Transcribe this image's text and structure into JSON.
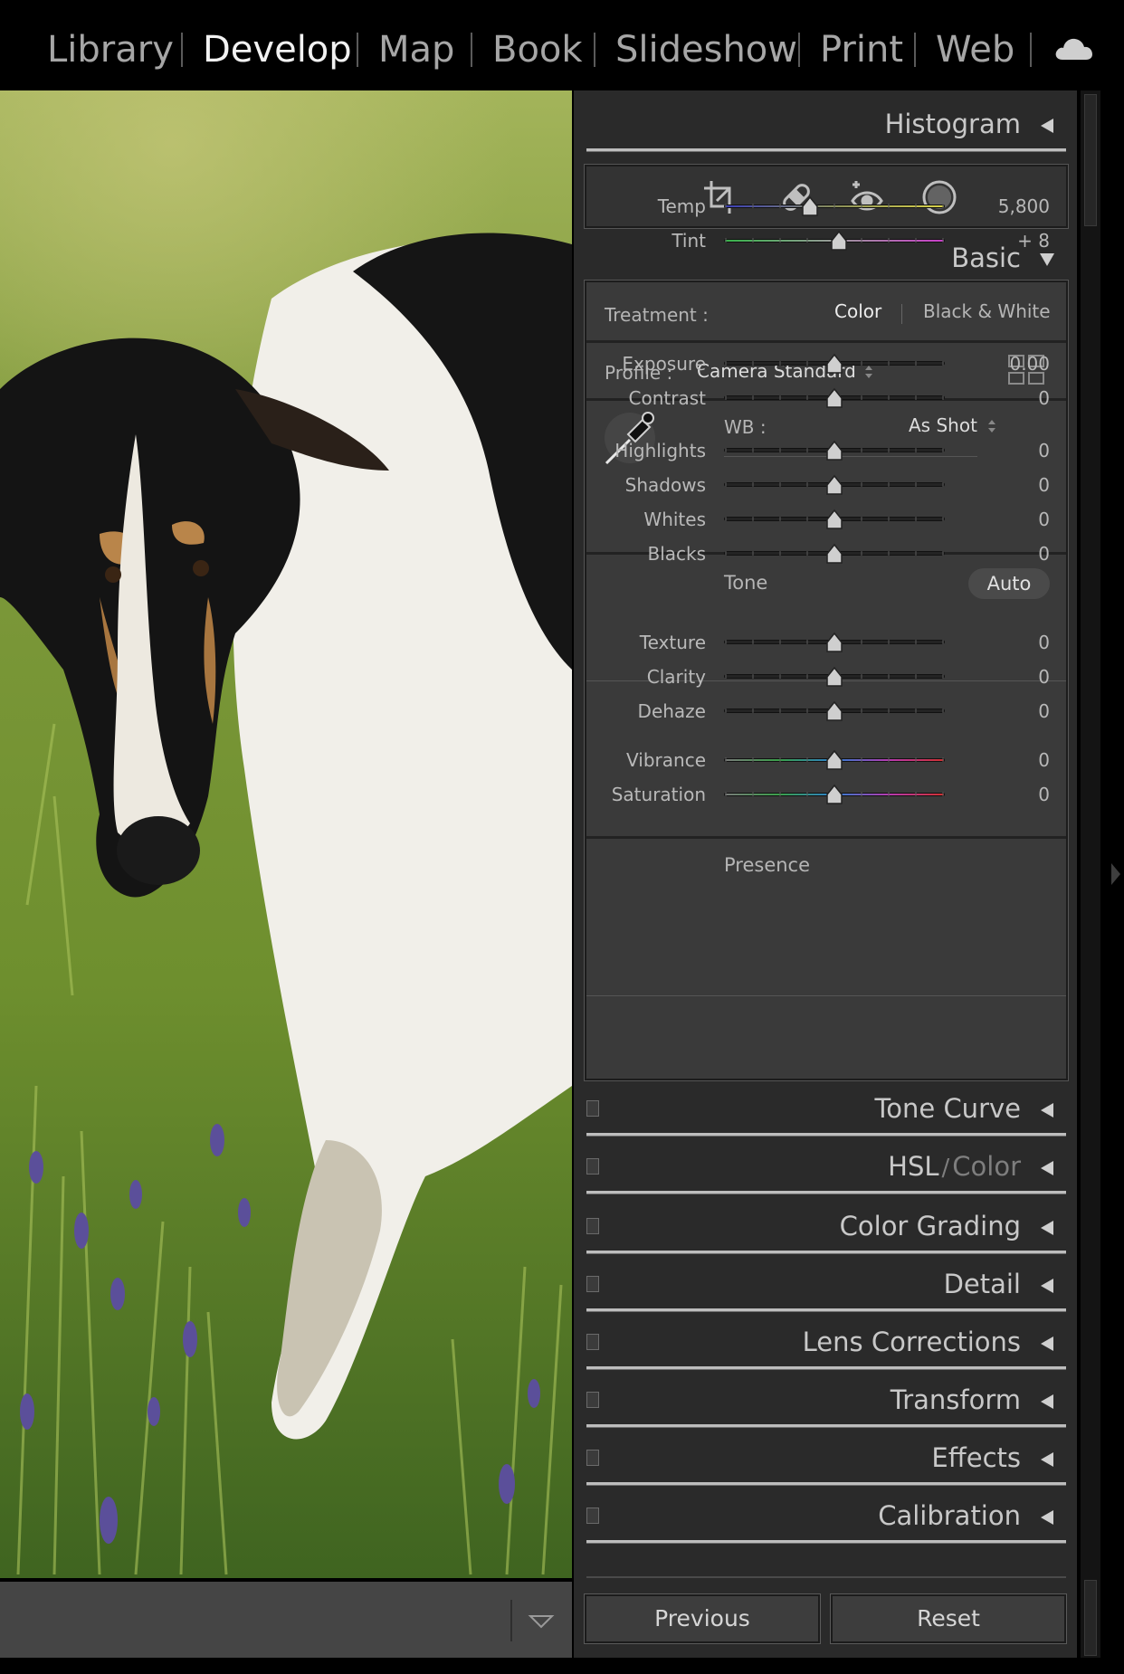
{
  "modules": {
    "library": "Library",
    "develop": "Develop",
    "map": "Map",
    "book": "Book",
    "slideshow": "Slideshow",
    "print": "Print",
    "web": "Web",
    "cloud_icon": "cloud-icon"
  },
  "panels": {
    "histogram": "Histogram",
    "basic": "Basic",
    "tone_curve": "Tone Curve",
    "hsl": "HSL",
    "hsl_slash": "/",
    "hsl_color": "Color",
    "color_grading": "Color Grading",
    "detail": "Detail",
    "lens_corrections": "Lens Corrections",
    "transform": "Transform",
    "effects": "Effects",
    "calibration": "Calibration"
  },
  "tools": [
    "crop-icon",
    "healing-icon",
    "redeye-icon",
    "masking-icon"
  ],
  "basic": {
    "treatment_label": "Treatment :",
    "treatment_color": "Color",
    "treatment_bw": "Black & White",
    "profile_label": "Profile :",
    "profile_value": "Camera Standard",
    "wb_label": "WB :",
    "wb_value": "As Shot",
    "tone_label": "Tone",
    "auto_label": "Auto",
    "presence_label": "Presence",
    "sliders": {
      "temp": {
        "label": "Temp",
        "value": "5,800",
        "position": 0.39
      },
      "tint": {
        "label": "Tint",
        "value": "+ 8",
        "position": 0.52
      },
      "exposure": {
        "label": "Exposure",
        "value": "0.00",
        "position": 0.5
      },
      "contrast": {
        "label": "Contrast",
        "value": "0",
        "position": 0.5
      },
      "highlights": {
        "label": "Highlights",
        "value": "0",
        "position": 0.5
      },
      "shadows": {
        "label": "Shadows",
        "value": "0",
        "position": 0.5
      },
      "whites": {
        "label": "Whites",
        "value": "0",
        "position": 0.5
      },
      "blacks": {
        "label": "Blacks",
        "value": "0",
        "position": 0.5
      },
      "texture": {
        "label": "Texture",
        "value": "0",
        "position": 0.5
      },
      "clarity": {
        "label": "Clarity",
        "value": "0",
        "position": 0.5
      },
      "dehaze": {
        "label": "Dehaze",
        "value": "0",
        "position": 0.5
      },
      "vibrance": {
        "label": "Vibrance",
        "value": "0",
        "position": 0.5
      },
      "saturation": {
        "label": "Saturation",
        "value": "0",
        "position": 0.5
      }
    }
  },
  "buttons": {
    "previous": "Previous",
    "reset": "Reset"
  }
}
